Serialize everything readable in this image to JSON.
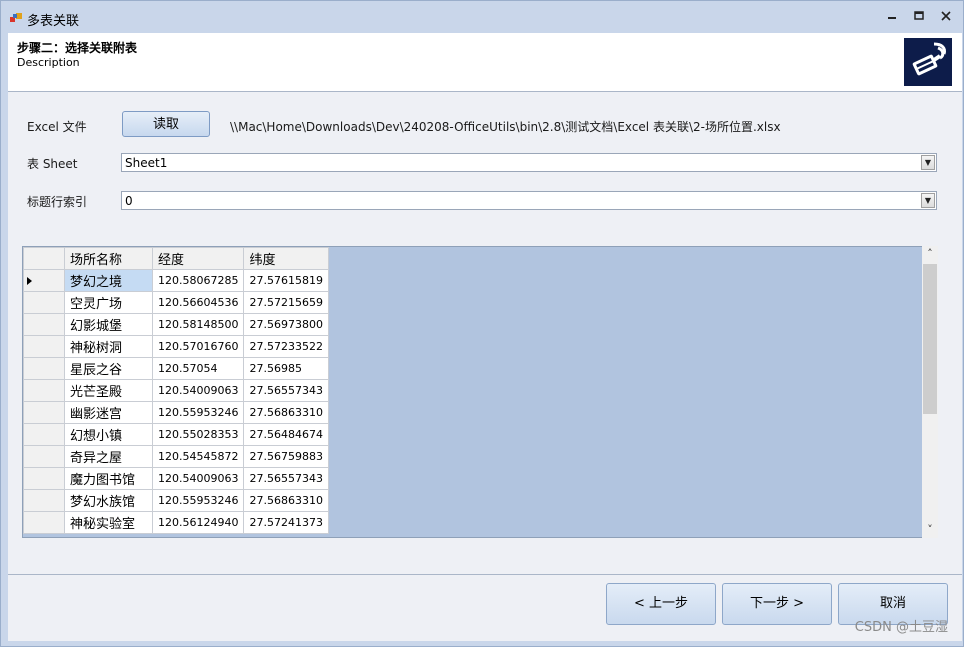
{
  "window": {
    "title": "多表关联",
    "minimize_icon": "minimize-icon",
    "maximize_icon": "maximize-icon",
    "close_icon": "close-icon",
    "accent": "#c9d6ea"
  },
  "header": {
    "step_title": "步骤二：选择关联附表",
    "description": "Description",
    "logo_icon": "network-cable-icon"
  },
  "form": {
    "excel_label": "Excel 文件",
    "read_button": "读取",
    "file_path": "\\\\Mac\\Home\\Downloads\\Dev\\240208-OfficeUtils\\bin\\2.8\\测试文档\\Excel 表关联\\2-场所位置.xlsx",
    "sheet_label": "表 Sheet",
    "sheet_value": "Sheet1",
    "header_row_label": "标题行索引",
    "header_row_value": "0"
  },
  "grid": {
    "columns": [
      "场所名称",
      "经度",
      "纬度"
    ],
    "rows": [
      [
        "梦幻之境",
        "120.58067285",
        "27.57615819"
      ],
      [
        "空灵广场",
        "120.56604536",
        "27.57215659"
      ],
      [
        "幻影城堡",
        "120.58148500",
        "27.56973800"
      ],
      [
        "神秘树洞",
        "120.57016760",
        "27.57233522"
      ],
      [
        "星辰之谷",
        "120.57054",
        "27.56985"
      ],
      [
        "光芒圣殿",
        "120.54009063",
        "27.56557343"
      ],
      [
        "幽影迷宫",
        "120.55953246",
        "27.56863310"
      ],
      [
        "幻想小镇",
        "120.55028353",
        "27.56484674"
      ],
      [
        "奇异之屋",
        "120.54545872",
        "27.56759883"
      ],
      [
        "魔力图书馆",
        "120.54009063",
        "27.56557343"
      ],
      [
        "梦幻水族馆",
        "120.55953246",
        "27.56863310"
      ],
      [
        "神秘实验室",
        "120.56124940",
        "27.57241373"
      ]
    ]
  },
  "footer": {
    "prev_button": "< 上一步",
    "next_button": "下一步 >",
    "cancel_button": "取消",
    "watermark": "CSDN @土豆湿"
  }
}
